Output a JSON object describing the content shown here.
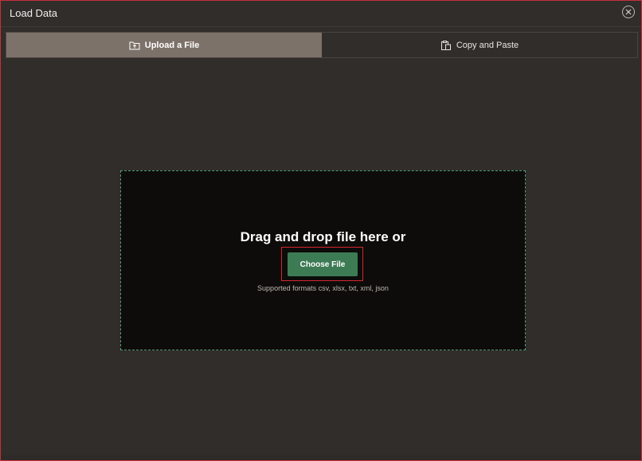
{
  "dialog": {
    "title": "Load Data",
    "close_icon": "close-icon"
  },
  "tabs": [
    {
      "label": "Upload a File",
      "icon": "upload-file-icon",
      "active": true
    },
    {
      "label": "Copy and Paste",
      "icon": "clipboard-icon",
      "active": false
    }
  ],
  "dropzone": {
    "heading": "Drag and drop file here or",
    "button_label": "Choose File",
    "formats_text": "Supported formats csv, xlsx, txt, xml, json"
  },
  "colors": {
    "background": "#312d2a",
    "active_tab": "#7d726a",
    "dropzone_bg": "#0e0c0a",
    "dropzone_border": "#4f9c78",
    "primary_button": "#3d7b55",
    "highlight": "#d4262f"
  }
}
